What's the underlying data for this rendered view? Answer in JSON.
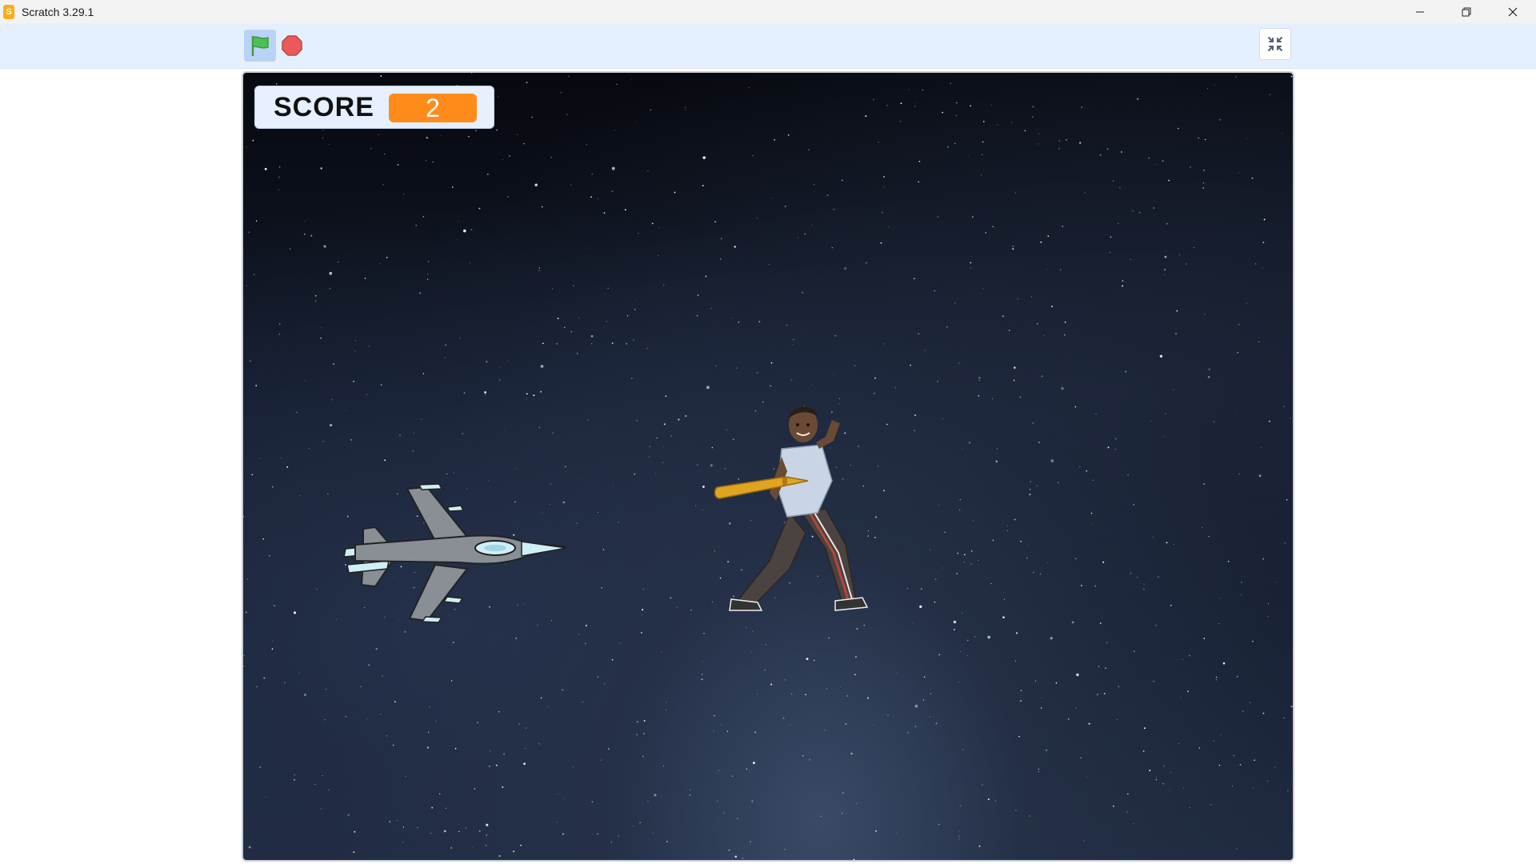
{
  "window": {
    "title": "Scratch 3.29.1",
    "app_icon": "scratch-cat-icon",
    "controls": [
      "minimize-icon",
      "restore-icon",
      "close-icon"
    ]
  },
  "toolbar": {
    "green_flag": "green-flag-icon",
    "stop": "stop-sign-icon",
    "unfullscreen": "unfullscreen-icon"
  },
  "stage": {
    "backdrop": "space-starfield",
    "monitor": {
      "label": "SCORE",
      "value": "2"
    },
    "sprites": [
      "fighter-jet",
      "boy-with-bat"
    ]
  },
  "colors": {
    "toolbar_bg": "#e5f0ff",
    "flag_active_bg": "#b9d3f7",
    "green_flag": "#4cbf56",
    "stop": "#ec5959",
    "monitor_value_bg": "#ff8c1a"
  }
}
